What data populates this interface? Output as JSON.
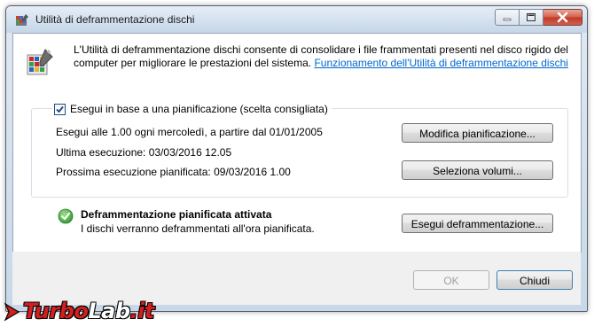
{
  "window": {
    "title": "Utilità di deframmentazione dischi"
  },
  "caption_buttons": [
    "minimize",
    "maximize",
    "close"
  ],
  "intro": {
    "text": "L'Utilità di deframmentazione dischi consente di consolidare i file frammentati presenti nel disco rigido del computer per migliorare le prestazioni del sistema.",
    "link": "Funzionamento dell'Utilità di deframmentazione dischi"
  },
  "schedule": {
    "checkbox_label": "Esegui in base a una pianificazione (scelta consigliata)",
    "checked": true,
    "run_info": "Esegui alle 1.00 ogni mercoledì, a partire dal 01/01/2005",
    "last_run": "Ultima esecuzione: 03/03/2016 12.05",
    "next_run": "Prossima esecuzione pianificata: 09/03/2016 1.00",
    "modify_button": "Modifica pianificazione...",
    "volumes_button": "Seleziona volumi..."
  },
  "status": {
    "title": "Deframmentazione pianificata attivata",
    "subtitle": "I dischi verranno deframmentati all'ora pianificata.",
    "run_button": "Esegui deframmentazione..."
  },
  "footer": {
    "ok_button": "OK",
    "close_button": "Chiudi"
  },
  "watermark": {
    "part1": "Turbo",
    "part2": "Lab",
    "part3": ".it"
  },
  "colors": {
    "link": "#0066cc",
    "status_ok": "#3aa53a",
    "watermark_red": "#d31f1f"
  }
}
